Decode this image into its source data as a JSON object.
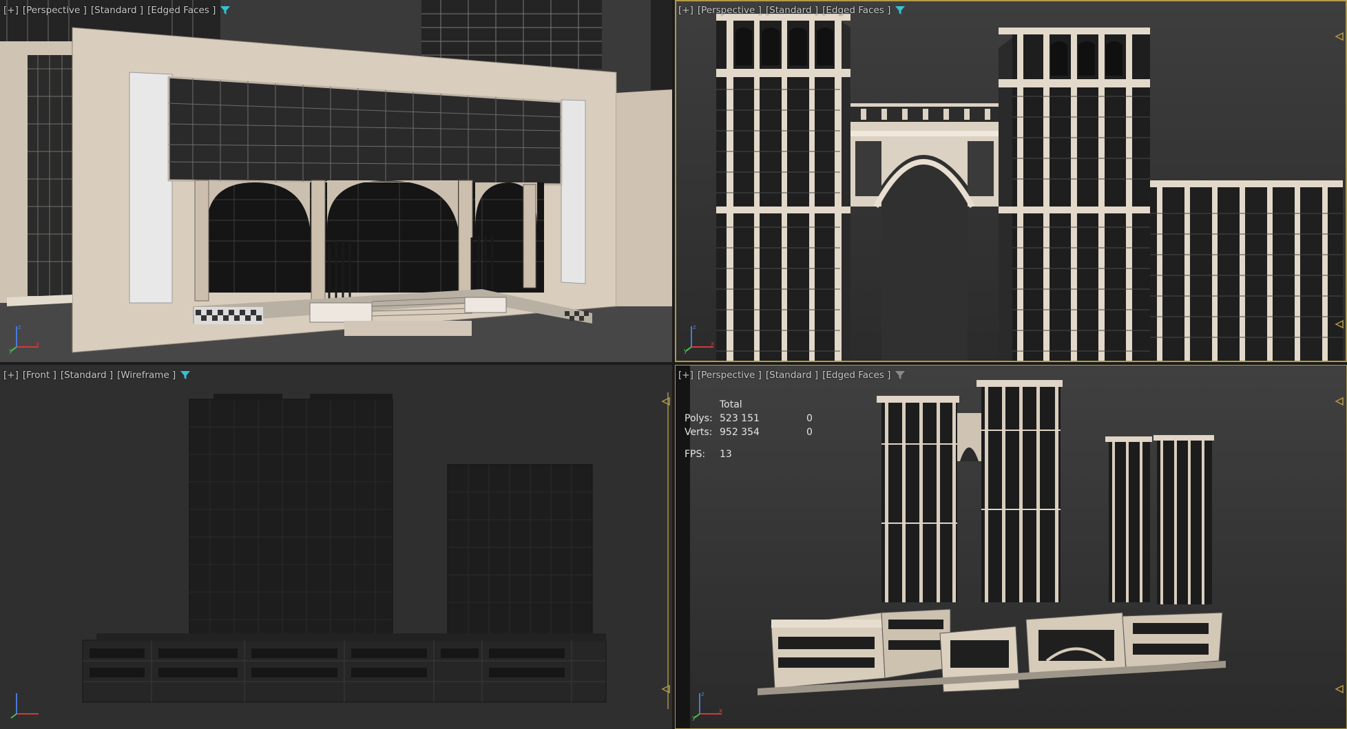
{
  "viewports": {
    "top_left": {
      "label": {
        "plus": "[+]",
        "view": "[Perspective ]",
        "shading": "[Standard ]",
        "mode": "[Edged Faces ]"
      },
      "filter_icon": "filter-icon",
      "filter_color": "#35c3d0",
      "active": false
    },
    "top_right": {
      "label": {
        "plus": "[+]",
        "view": "[Perspective ]",
        "shading": "[Standard ]",
        "mode": "[Edged Faces ]"
      },
      "filter_icon": "filter-icon",
      "filter_color": "#35c3d0",
      "active": true
    },
    "bottom_left": {
      "label": {
        "plus": "[+]",
        "view": "[Front ]",
        "shading": "[Standard ]",
        "mode": "[Wireframe ]"
      },
      "filter_icon": "filter-icon",
      "filter_color": "#35c3d0",
      "active": false
    },
    "bottom_right": {
      "label": {
        "plus": "[+]",
        "view": "[Perspective ]",
        "shading": "[Standard ]",
        "mode": "[Edged Faces ]"
      },
      "filter_icon": "filter-icon",
      "filter_color": "#8a8a8a",
      "active": true,
      "stats": {
        "header": "Total",
        "polys_label": "Polys:",
        "polys_value": "523 151",
        "polys_selected": "0",
        "verts_label": "Verts:",
        "verts_value": "952 354",
        "verts_selected": "0",
        "fps_label": "FPS:",
        "fps_value": "13"
      }
    }
  },
  "colors": {
    "active_border": "#b49a47",
    "axis_x": "#d23a3a",
    "axis_y": "#4ac04a",
    "axis_z": "#4a7ad8",
    "facade_light": "#d8cbbb",
    "glass_dark": "#202020"
  }
}
